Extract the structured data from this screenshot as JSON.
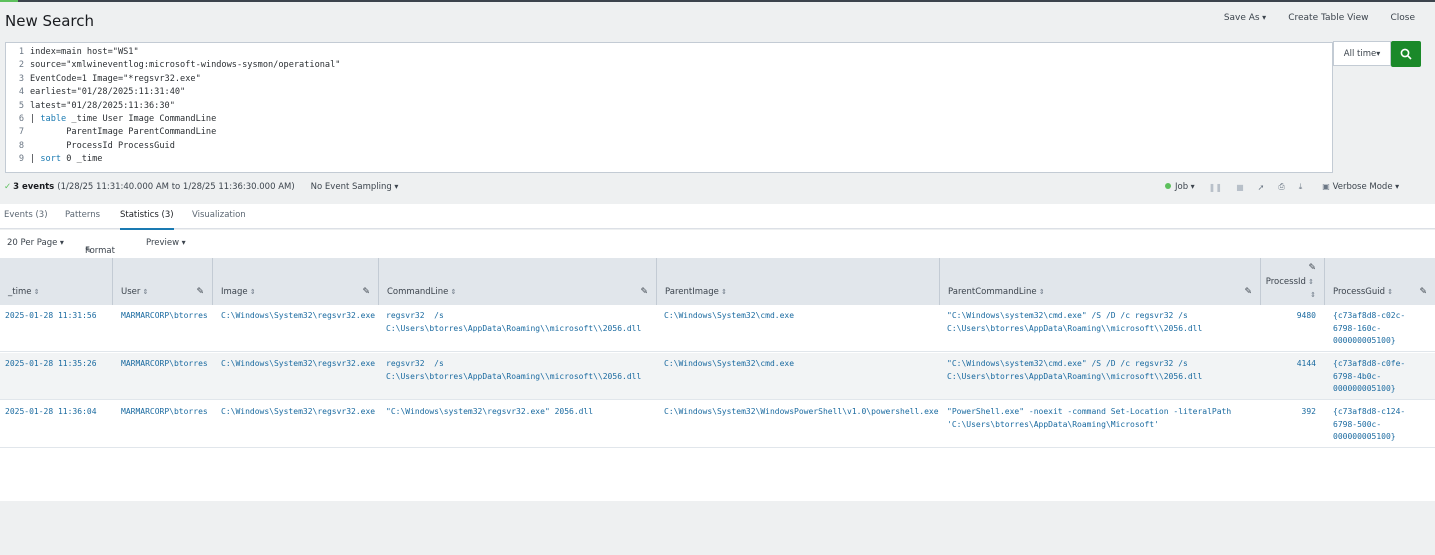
{
  "header": {
    "title": "New Search",
    "save_as": "Save As",
    "create_table_view": "Create Table View",
    "close": "Close"
  },
  "search": {
    "lines": [
      {
        "num": "1",
        "text": "index=main host=\"WS1\""
      },
      {
        "num": "2",
        "text": "source=\"xmlwineventlog:microsoft-windows-sysmon/operational\""
      },
      {
        "num": "3",
        "text": "EventCode=1 Image=\"*regsvr32.exe\""
      },
      {
        "num": "4",
        "text": "earliest=\"01/28/2025:11:31:40\""
      },
      {
        "num": "5",
        "text": "latest=\"01/28/2025:11:36:30\""
      },
      {
        "num": "6",
        "pipe": "| ",
        "cmd": "table",
        "text": " _time User Image CommandLine"
      },
      {
        "num": "7",
        "text": "       ParentImage ParentCommandLine"
      },
      {
        "num": "8",
        "text": "       ProcessId ProcessGuid"
      },
      {
        "num": "9",
        "pipe": "| ",
        "cmd": "sort",
        "text": " 0 _time"
      }
    ],
    "time_range": "All time",
    "search_icon": "search-icon"
  },
  "status": {
    "events": "3 events",
    "range": "(1/28/25 11:31:40.000 AM to 1/28/25 11:36:30.000 AM)",
    "sampling": "No Event Sampling",
    "job": "Job",
    "mode": "Verbose Mode"
  },
  "tabs": [
    {
      "label": "Events (3)"
    },
    {
      "label": "Patterns"
    },
    {
      "label": "Statistics (3)"
    },
    {
      "label": "Visualization"
    }
  ],
  "toolbar": {
    "per_page": "20 Per Page",
    "format": "Format",
    "preview": "Preview"
  },
  "table": {
    "columns": [
      "_time",
      "User",
      "Image",
      "CommandLine",
      "ParentImage",
      "ParentCommandLine",
      "ProcessId",
      "ProcessGuid"
    ],
    "rows": [
      {
        "time": "2025-01-28 11:31:56",
        "user": "MARMARCORP\\btorres",
        "image": "C:\\Windows\\System32\\regsvr32.exe",
        "commandline": "regsvr32  /s\nC:\\Users\\btorres\\AppData\\Roaming\\\\microsoft\\\\2056.dll",
        "parentimage": "C:\\Windows\\System32\\cmd.exe",
        "parentcommandline": "\"C:\\Windows\\system32\\cmd.exe\" /S /D /c regsvr32 /s\nC:\\Users\\btorres\\AppData\\Roaming\\\\microsoft\\\\2056.dll",
        "processid": "9480",
        "processguid": "{c73af8d8-c02c-\n6798-160c-\n000000005100}"
      },
      {
        "time": "2025-01-28 11:35:26",
        "user": "MARMARCORP\\btorres",
        "image": "C:\\Windows\\System32\\regsvr32.exe",
        "commandline": "regsvr32  /s\nC:\\Users\\btorres\\AppData\\Roaming\\\\microsoft\\\\2056.dll",
        "parentimage": "C:\\Windows\\System32\\cmd.exe",
        "parentcommandline": "\"C:\\Windows\\system32\\cmd.exe\" /S /D /c regsvr32 /s\nC:\\Users\\btorres\\AppData\\Roaming\\\\microsoft\\\\2056.dll",
        "processid": "4144",
        "processguid": "{c73af8d8-c0fe-\n6798-4b0c-\n000000005100}"
      },
      {
        "time": "2025-01-28 11:36:04",
        "user": "MARMARCORP\\btorres",
        "image": "C:\\Windows\\System32\\regsvr32.exe",
        "commandline": "\"C:\\Windows\\system32\\regsvr32.exe\" 2056.dll",
        "parentimage": "C:\\Windows\\System32\\WindowsPowerShell\\v1.0\\powershell.exe",
        "parentcommandline": "\"PowerShell.exe\" -noexit -command Set-Location -literalPath\n'C:\\Users\\btorres\\AppData\\Roaming\\Microsoft'",
        "processid": "392",
        "processguid": "{c73af8d8-c124-\n6798-500c-\n000000005100}"
      }
    ]
  },
  "colors": {
    "accent": "#1a7ab2",
    "go_button": "#1a8929",
    "success": "#5cc05c",
    "link_text": "#1a6aa0"
  }
}
